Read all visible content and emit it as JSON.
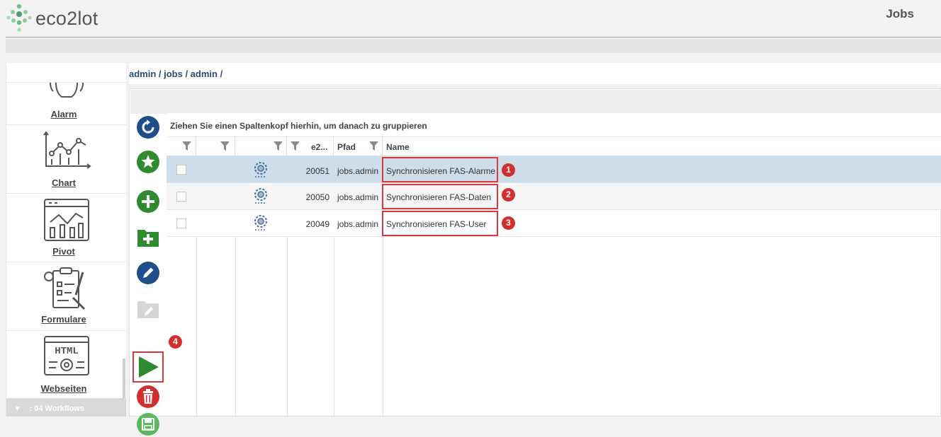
{
  "header": {
    "app_name": "eco2lot",
    "page_title": "Jobs"
  },
  "breadcrumb": "admin / jobs / admin /",
  "sidebar": {
    "items": [
      {
        "label": "Alarm",
        "icon": "bell-icon"
      },
      {
        "label": "Chart",
        "icon": "chart-icon"
      },
      {
        "label": "Pivot",
        "icon": "pivot-icon"
      },
      {
        "label": "Formulare",
        "icon": "form-icon"
      },
      {
        "label": "Webseiten",
        "icon": "html-icon"
      }
    ],
    "workflow_group": ": 04 Workflows"
  },
  "toolbar": [
    {
      "name": "refresh",
      "icon": "refresh-icon"
    },
    {
      "name": "favorite",
      "icon": "star-icon"
    },
    {
      "name": "add",
      "icon": "plus-icon"
    },
    {
      "name": "add-folder",
      "icon": "folder-plus-icon"
    },
    {
      "name": "edit",
      "icon": "pencil-icon"
    },
    {
      "name": "edit-folder",
      "icon": "folder-edit-icon"
    },
    {
      "name": "run",
      "icon": "play-icon"
    },
    {
      "name": "delete",
      "icon": "trash-icon"
    },
    {
      "name": "save",
      "icon": "save-icon"
    }
  ],
  "grid": {
    "group_hint": "Ziehen Sie einen Spaltenkopf hierhin, um danach zu gruppieren",
    "columns": {
      "id": "e2...",
      "path": "Pfad",
      "name": "Name"
    },
    "rows": [
      {
        "id": "20051",
        "path": "jobs.admin",
        "name": "Synchronisieren FAS-Alarme",
        "badge": "1",
        "selected": true
      },
      {
        "id": "20050",
        "path": "jobs.admin",
        "name": "Synchronisieren FAS-Daten",
        "badge": "2",
        "selected": false
      },
      {
        "id": "20049",
        "path": "jobs.admin",
        "name": "Synchronisieren FAS-User",
        "badge": "3",
        "selected": false
      }
    ]
  },
  "annotations": {
    "run_badge": "4"
  },
  "colors": {
    "highlight": "#d9393c",
    "badge": "#d32f2f",
    "blue_btn": "#1f4e8a",
    "green_btn": "#2e8b2e",
    "selected_row": "#cddde9"
  }
}
